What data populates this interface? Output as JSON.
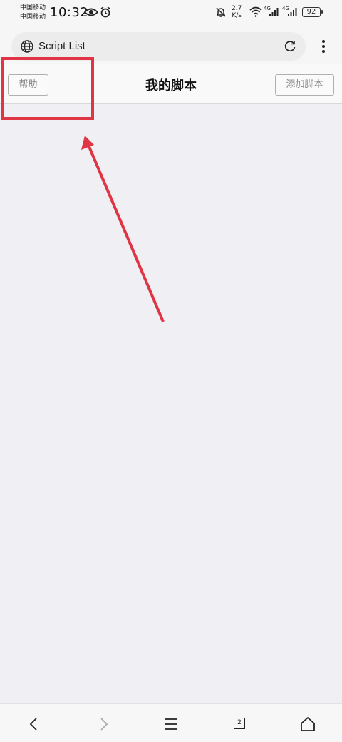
{
  "status_bar": {
    "carrier_1": "中国移动",
    "carrier_2": "中国移动",
    "time": "10:32",
    "net_speed_value": "2.7",
    "net_speed_unit": "K/s",
    "signal_1_tag": "4G",
    "signal_2_tag": "4G",
    "battery": "92",
    "icons": [
      "eye-icon",
      "alarm-icon",
      "mute-bell-icon",
      "wifi-icon",
      "signal-icon",
      "signal-icon",
      "battery-icon"
    ]
  },
  "browser": {
    "url_text": "Script List",
    "icons": [
      "globe-icon",
      "reload-icon",
      "more-menu-icon"
    ]
  },
  "page": {
    "title": "我的脚本",
    "help_button": "帮助",
    "add_button": "添加脚本"
  },
  "bottom_nav": {
    "tab_count": "2",
    "icons": [
      "back-icon",
      "forward-icon",
      "menu-icon",
      "tabs-icon",
      "home-icon"
    ]
  },
  "annotation_color": "#e03545"
}
